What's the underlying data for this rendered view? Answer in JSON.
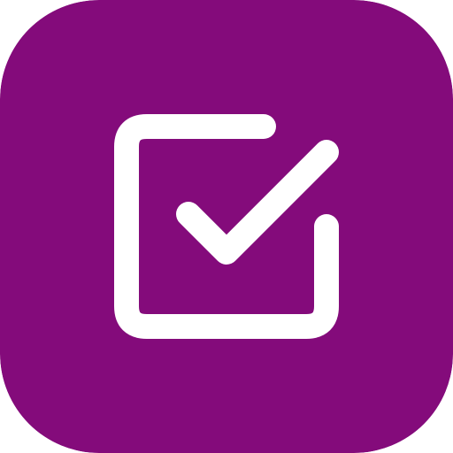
{
  "app_icon": {
    "icon": "checkbox-checked-icon",
    "background_color": "#840B7B",
    "glyph_color": "#FFFFFF"
  }
}
